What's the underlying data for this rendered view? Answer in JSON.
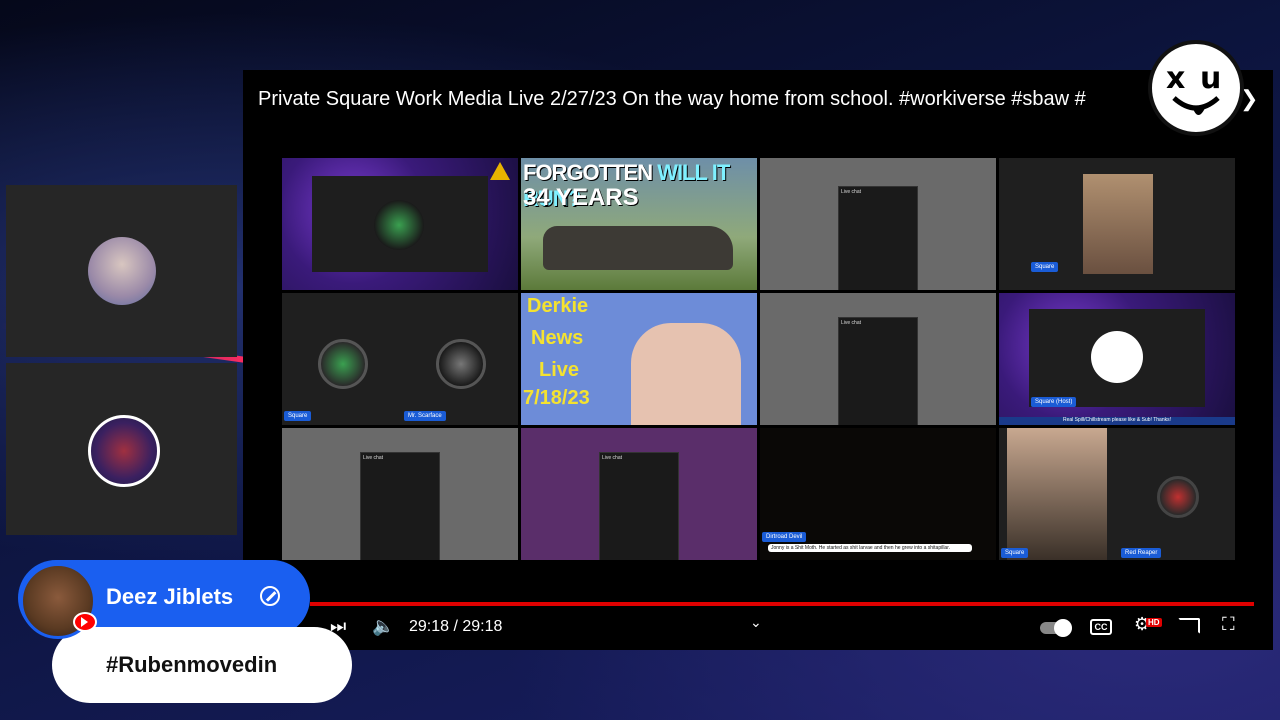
{
  "stream": {
    "title": "Private Square Work Media Live 2/27/23 On the way home from school. #workiverse #sbaw #",
    "current_time": "29:18",
    "duration": "29:18",
    "time_display": "29:18 / 29:18",
    "progress": 1.0
  },
  "tiles": {
    "derkie_line1": "Derkie",
    "derkie_line2": "News",
    "derkie_line3": "Live",
    "derkie_line4": "7/18/23",
    "forgotten_line1": "FORGOTTEN",
    "forgotten_line1b": "WILL IT RUN?",
    "forgotten_line2": "34 YEARS",
    "square_tag": "Square",
    "square_tag2": "Square",
    "mr_scarface_tag": "Mr. Scarface",
    "square_host_tag": "Square (Host)",
    "red_reaper_tag": "Red Reaper",
    "square_tag3": "Square",
    "dirtroad_tag": "Dirtroad Devil",
    "caption": "Jonny is a Shit Moth. He started as shit larvae and then he grew into a shitapillar.",
    "host_banner": "Real Spill/Chillstream please like & Sub! Thanks!",
    "live_chat": "Live chat"
  },
  "chat_overlay": {
    "username": "Deez Jiblets",
    "message": "#Rubenmovedin"
  },
  "colors": {
    "accent_blue": "#1a5ff0",
    "progress_red": "#e00000",
    "name_tag_blue": "#1a5cd6"
  }
}
